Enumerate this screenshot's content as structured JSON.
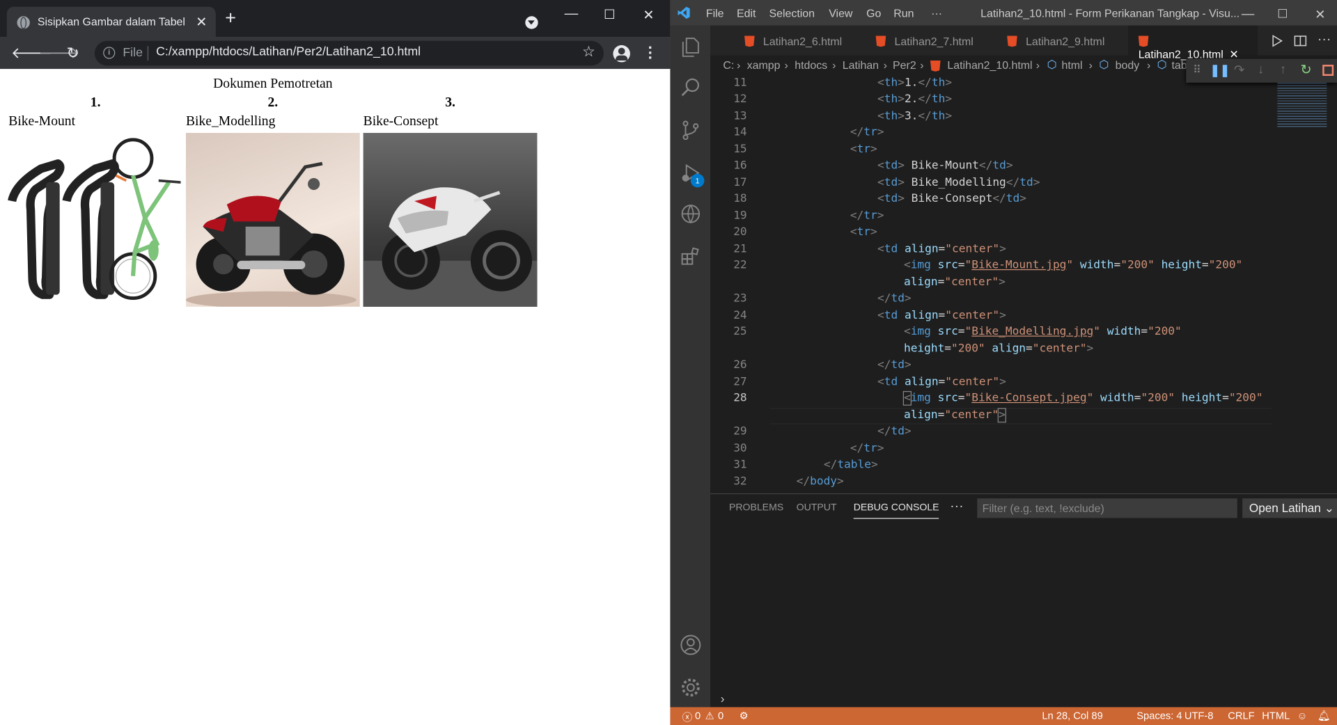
{
  "browser": {
    "tab_title": "Sisipkan Gambar dalam Tabel",
    "address_scheme": "File",
    "url": "C:/xampp/htdocs/Latihan/Per2/Latihan2_10.html"
  },
  "page": {
    "caption": "Dokumen Pemotretan",
    "headers": [
      "1.",
      "2.",
      "3."
    ],
    "cells": [
      "Bike-Mount",
      "Bike_Modelling",
      "Bike-Consept"
    ]
  },
  "vscode": {
    "menu": [
      "File",
      "Edit",
      "Selection",
      "View",
      "Go",
      "Run",
      "···"
    ],
    "window_title": "Latihan2_10.html - Form Perikanan Tangkap - Visu...",
    "tabs": [
      "Latihan2_6.html",
      "Latihan2_7.html",
      "Latihan2_9.html",
      "Latihan2_10.html"
    ],
    "breadcrumb": [
      "C:",
      "xampp",
      "htdocs",
      "Latihan",
      "Per2",
      "Latihan2_10.html",
      "html",
      "body",
      "tab"
    ],
    "line_numbers": [
      "11",
      "12",
      "13",
      "14",
      "15",
      "16",
      "17",
      "18",
      "19",
      "20",
      "21",
      "22",
      "",
      "23",
      "24",
      "25",
      "",
      "26",
      "27",
      "28",
      "",
      "29",
      "30",
      "31",
      "32"
    ],
    "panel_tabs": [
      "PROBLEMS",
      "OUTPUT",
      "DEBUG CONSOLE"
    ],
    "panel_filter_placeholder": "Filter (e.g. text, !exclude)",
    "panel_open_select": "Open Latihan",
    "debug_badge": "1",
    "status": {
      "errors": "0",
      "warnings": "0",
      "position": "Ln 28, Col 89",
      "spaces": "Spaces: 4",
      "encoding": "UTF-8",
      "eol": "CRLF",
      "language": "HTML"
    },
    "colors": {
      "status_bar": "#cc6633",
      "html_icon": "#e44d26",
      "accent": "#569cd6"
    }
  }
}
